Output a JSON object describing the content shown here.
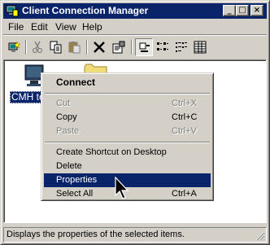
{
  "window": {
    "title": "Client Connection Manager",
    "minimize": "_",
    "maximize": "□",
    "close": "×"
  },
  "menubar": [
    "File",
    "Edit",
    "View",
    "Help"
  ],
  "toolbar": {
    "icons": [
      "new-connection-icon",
      "cut-icon",
      "copy-icon",
      "paste-icon",
      "delete-icon",
      "properties-icon",
      "large-icons-view-icon",
      "small-icons-view-icon",
      "list-view-icon",
      "details-view-icon"
    ]
  },
  "content": {
    "selected_item_label": "CMH te"
  },
  "context_menu": {
    "items": [
      {
        "label": "Connect",
        "shortcut": "",
        "bold": true
      },
      {
        "label": "Cut",
        "shortcut": "Ctrl+X",
        "disabled": true
      },
      {
        "label": "Copy",
        "shortcut": "Ctrl+C"
      },
      {
        "label": "Paste",
        "shortcut": "Ctrl+V",
        "disabled": true
      },
      {
        "label": "Create Shortcut on Desktop",
        "shortcut": ""
      },
      {
        "label": "Delete",
        "shortcut": ""
      },
      {
        "label": "Properties",
        "shortcut": "",
        "selected": true
      },
      {
        "label": "Select All",
        "shortcut": "Ctrl+A"
      }
    ]
  },
  "status_bar": {
    "text": "Displays the properties of the selected items."
  },
  "colors": {
    "titlebar": "#0a246a",
    "selection": "#0a246a",
    "face": "#d4d0c8"
  }
}
